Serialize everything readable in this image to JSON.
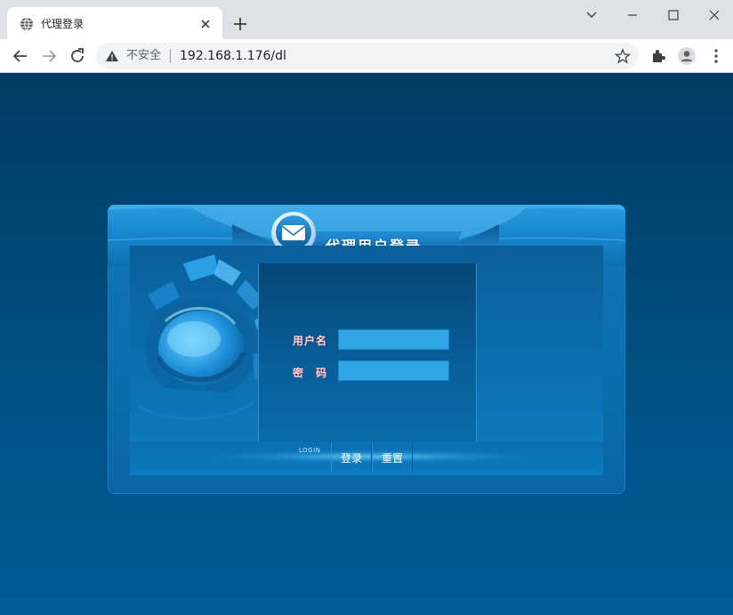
{
  "browser": {
    "tab_title": "代理登录",
    "security_label": "不安全",
    "url": "192.168.1.176/dl"
  },
  "login": {
    "title": "代理用户登录",
    "username_label": "用户名",
    "username_value": "",
    "password_label": "密　码",
    "password_value": "",
    "caption": "LOGIN",
    "login_button": "登录",
    "reset_button": "重置"
  },
  "colors": {
    "page_background": "#003c63",
    "panel": "#0f77b6",
    "input_fill": "#31a5e6",
    "label_text": "#ffd2d6"
  },
  "icons": [
    "globe-icon",
    "close-icon",
    "plus-icon",
    "chevron-down-icon",
    "minimize-icon",
    "maximize-icon",
    "window-close-icon",
    "back-arrow-icon",
    "forward-arrow-icon",
    "reload-icon",
    "warning-icon",
    "star-icon",
    "extension-icon",
    "profile-icon",
    "kebab-menu-icon",
    "mail-icon"
  ]
}
